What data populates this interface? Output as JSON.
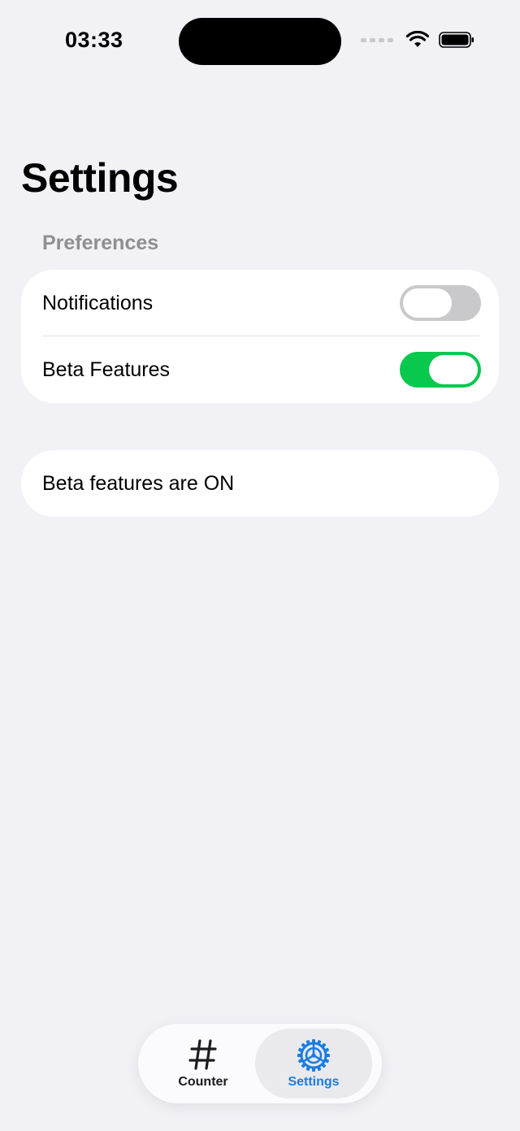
{
  "status_bar": {
    "time": "03:33"
  },
  "page": {
    "title": "Settings"
  },
  "preferences": {
    "header": "Preferences",
    "items": [
      {
        "label": "Notifications",
        "enabled": false
      },
      {
        "label": "Beta Features",
        "enabled": true
      }
    ]
  },
  "status_message": "Beta features are ON",
  "tab_bar": {
    "tabs": [
      {
        "label": "Counter",
        "icon": "number-sign-icon",
        "selected": false
      },
      {
        "label": "Settings",
        "icon": "gear-icon",
        "selected": true
      }
    ]
  },
  "colors": {
    "accent": "#1a7de0",
    "toggle_on": "#09c84e",
    "toggle_off": "#c9c9cc",
    "background": "#f1f1f6"
  }
}
